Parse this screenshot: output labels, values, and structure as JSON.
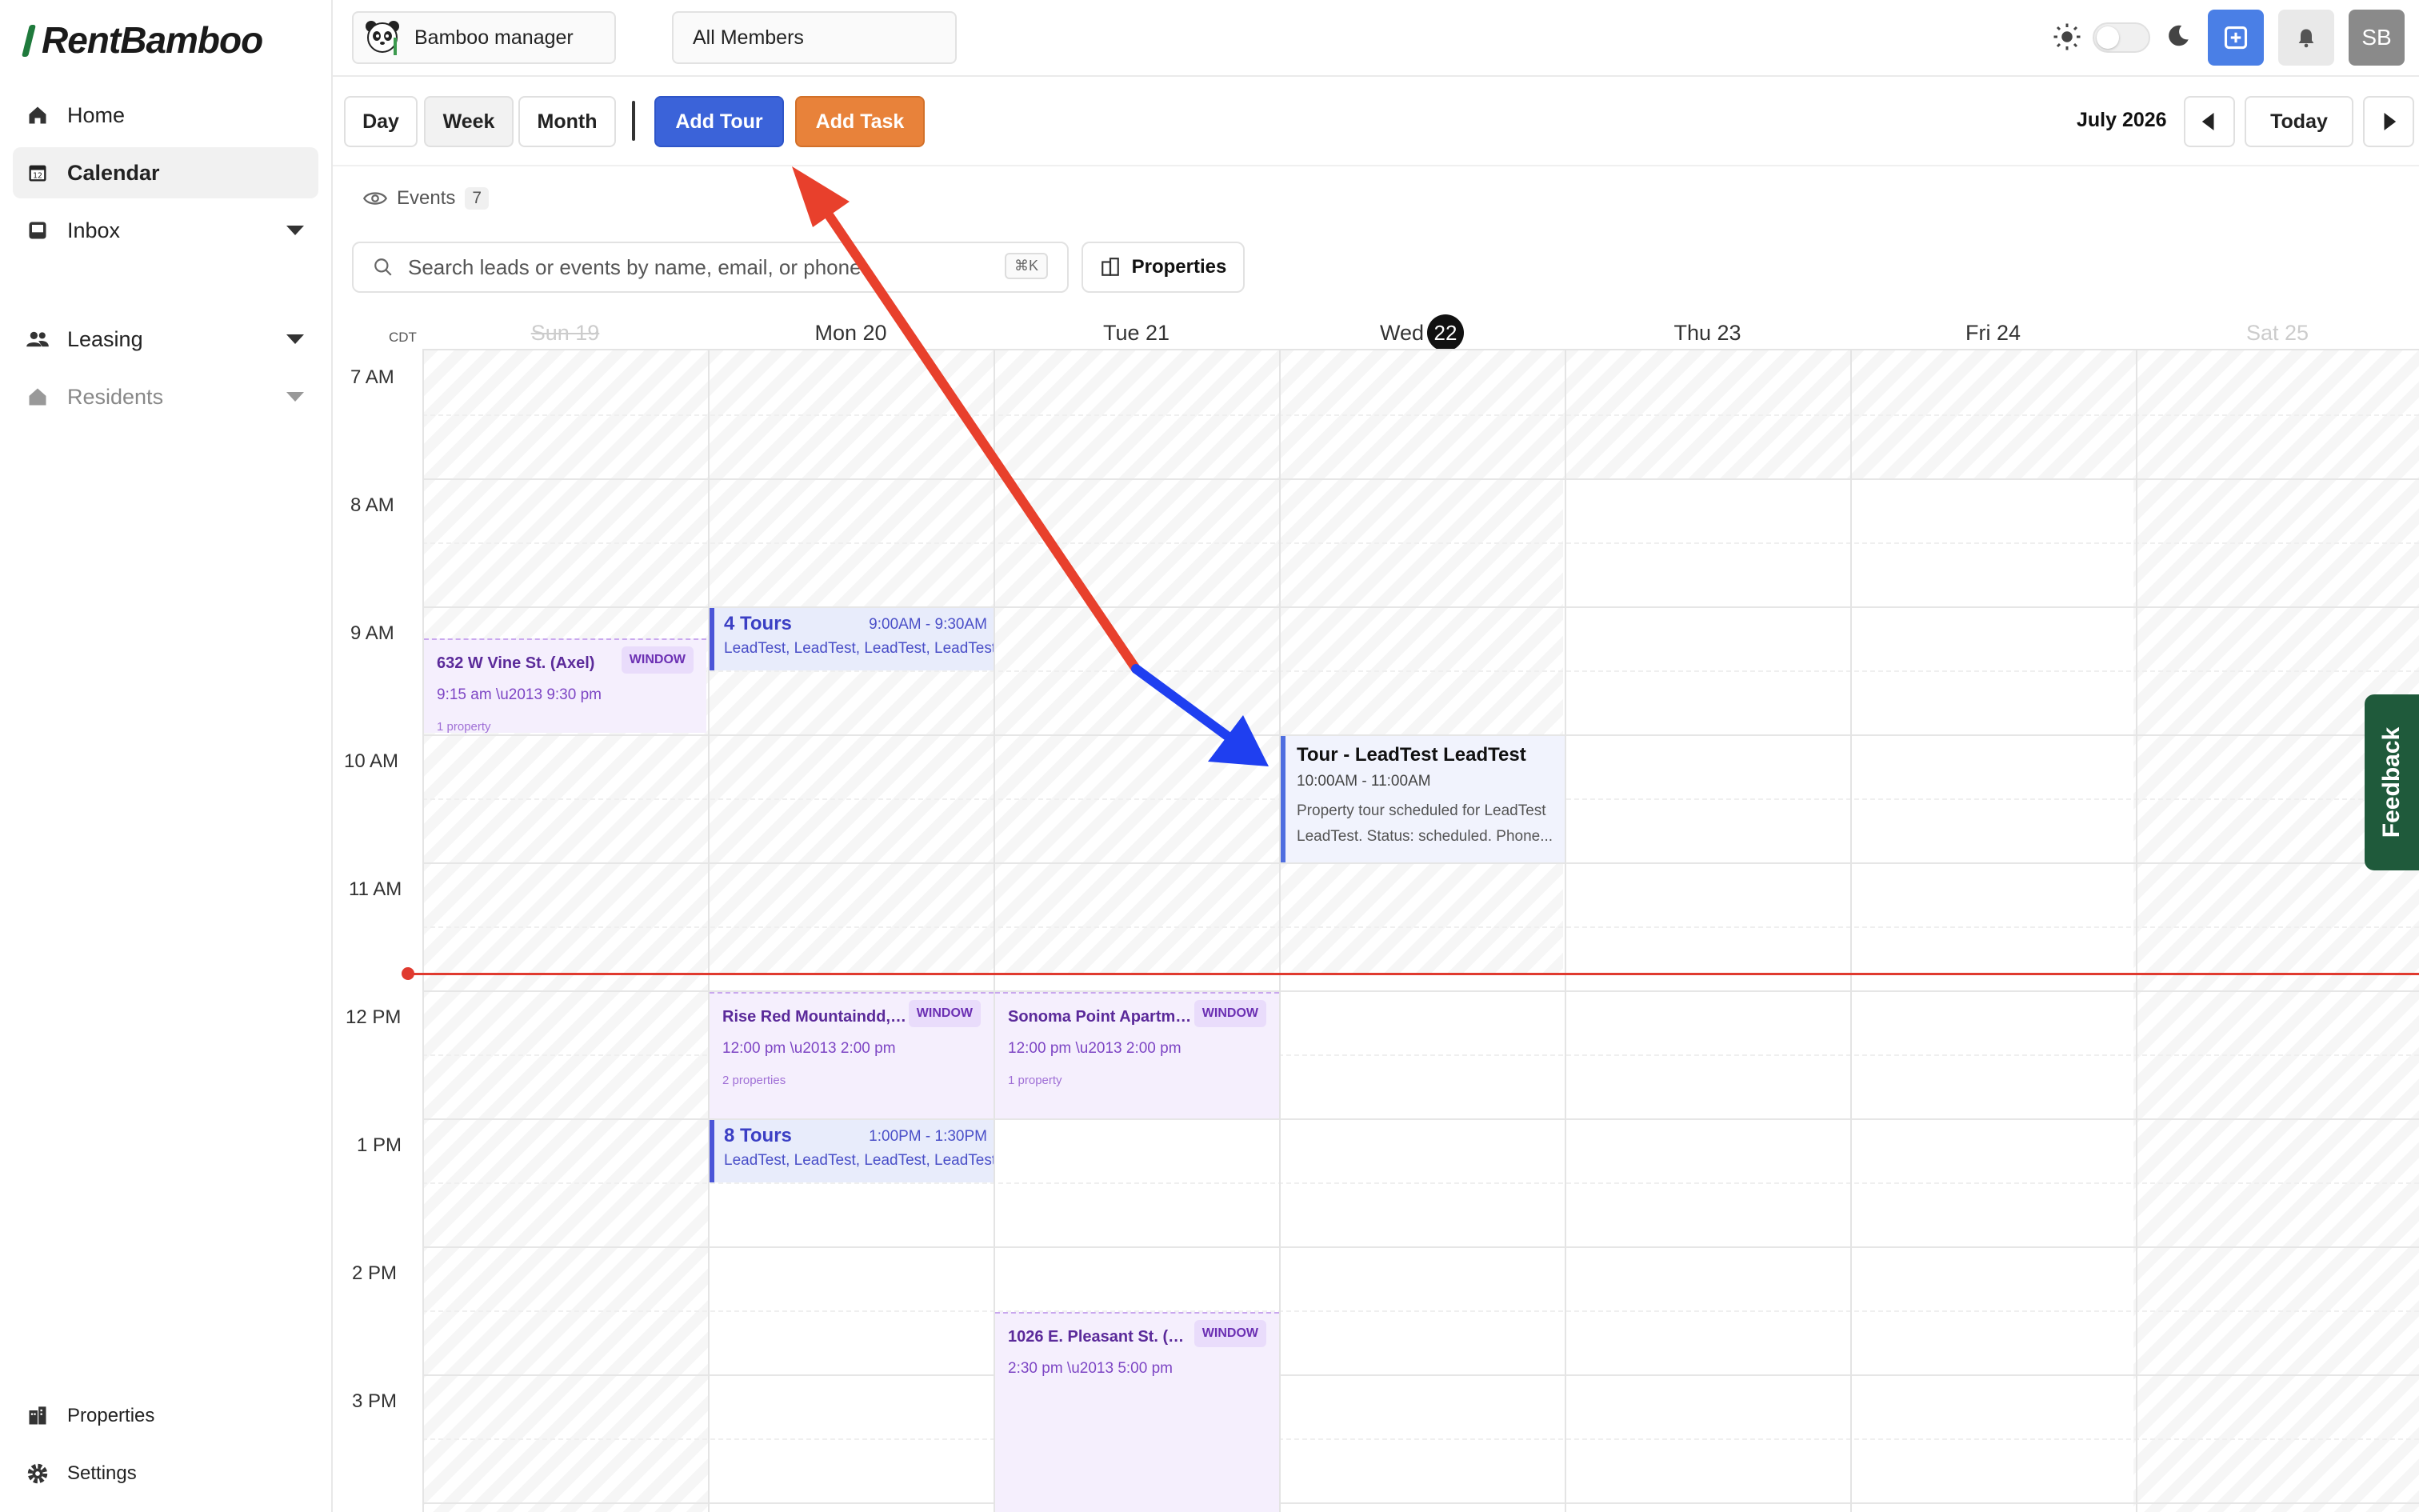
{
  "app": {
    "logo_text": "RentBamboo"
  },
  "sidebar": {
    "items": [
      {
        "label": "Home",
        "icon": "home-icon"
      },
      {
        "label": "Calendar",
        "icon": "calendar-icon"
      },
      {
        "label": "Inbox",
        "icon": "inbox-icon"
      },
      {
        "label": "Leasing",
        "icon": "users-icon"
      },
      {
        "label": "Residents",
        "icon": "house-icon"
      }
    ],
    "bottom": [
      {
        "label": "Properties",
        "icon": "building-icon"
      },
      {
        "label": "Settings",
        "icon": "gear-icon"
      }
    ]
  },
  "topbar": {
    "account": "Bamboo manager",
    "members": "All Members",
    "avatar": "SB",
    "accent": "#4a7fe6"
  },
  "toolbar": {
    "views": [
      "Day",
      "Week",
      "Month"
    ],
    "selected_view": "Week",
    "add_tour": "Add Tour",
    "add_task": "Add Task",
    "month_label": "July 2026",
    "today": "Today"
  },
  "filters": {
    "events_label": "Events",
    "events_count": "7",
    "search_placeholder": "Search leads or events by name, email, or phone",
    "search_shortcut": "⌘K",
    "properties_button": "Properties"
  },
  "calendar": {
    "timezone": "CDT",
    "days": [
      "Sun 19",
      "Mon 20",
      "Tue 21",
      "Wed",
      "Thu 23",
      "Fri 24",
      "Sat 25"
    ],
    "today_number": "22",
    "hours": [
      "7 AM",
      "8 AM",
      "9 AM",
      "10 AM",
      "11 AM",
      "12 PM",
      "1 PM",
      "2 PM",
      "3 PM"
    ],
    "events": {
      "vine": {
        "title": "632 W Vine St. (Axel)",
        "tag": "WINDOW",
        "time": "9:15 am \\u2013 9:30 pm",
        "count": "1 property"
      },
      "tours4": {
        "title": "4 Tours",
        "time": "9:00AM - 9:30AM",
        "who": "LeadTest, LeadTest, LeadTest, LeadTest"
      },
      "tour": {
        "title": "Tour - LeadTest LeadTest",
        "time": "10:00AM - 11:00AM",
        "desc": "Property tour scheduled for LeadTest LeadTest. Status: scheduled. Phone..."
      },
      "rise": {
        "title": "Rise Red Mountaindd,(...",
        "tag": "WINDOW",
        "time": "12:00 pm \\u2013 2:00 pm",
        "count": "2 properties"
      },
      "sonoma": {
        "title": "Sonoma Point Apartme...",
        "tag": "WINDOW",
        "time": "12:00 pm \\u2013 2:00 pm",
        "count": "1 property"
      },
      "tours8": {
        "title": "8 Tours",
        "time": "1:00PM - 1:30PM",
        "who": "LeadTest, LeadTest, LeadTest, LeadTest"
      },
      "pleasant": {
        "title": "1026 E. Pleasant St. (Su...",
        "tag": "WINDOW",
        "time": "2:30 pm \\u2013 5:00 pm"
      }
    }
  },
  "feedback": "Feedback",
  "colors": {
    "now_line": "#e03a2f",
    "annotation_red": "#e8402c",
    "annotation_blue": "#1f3ff0"
  }
}
